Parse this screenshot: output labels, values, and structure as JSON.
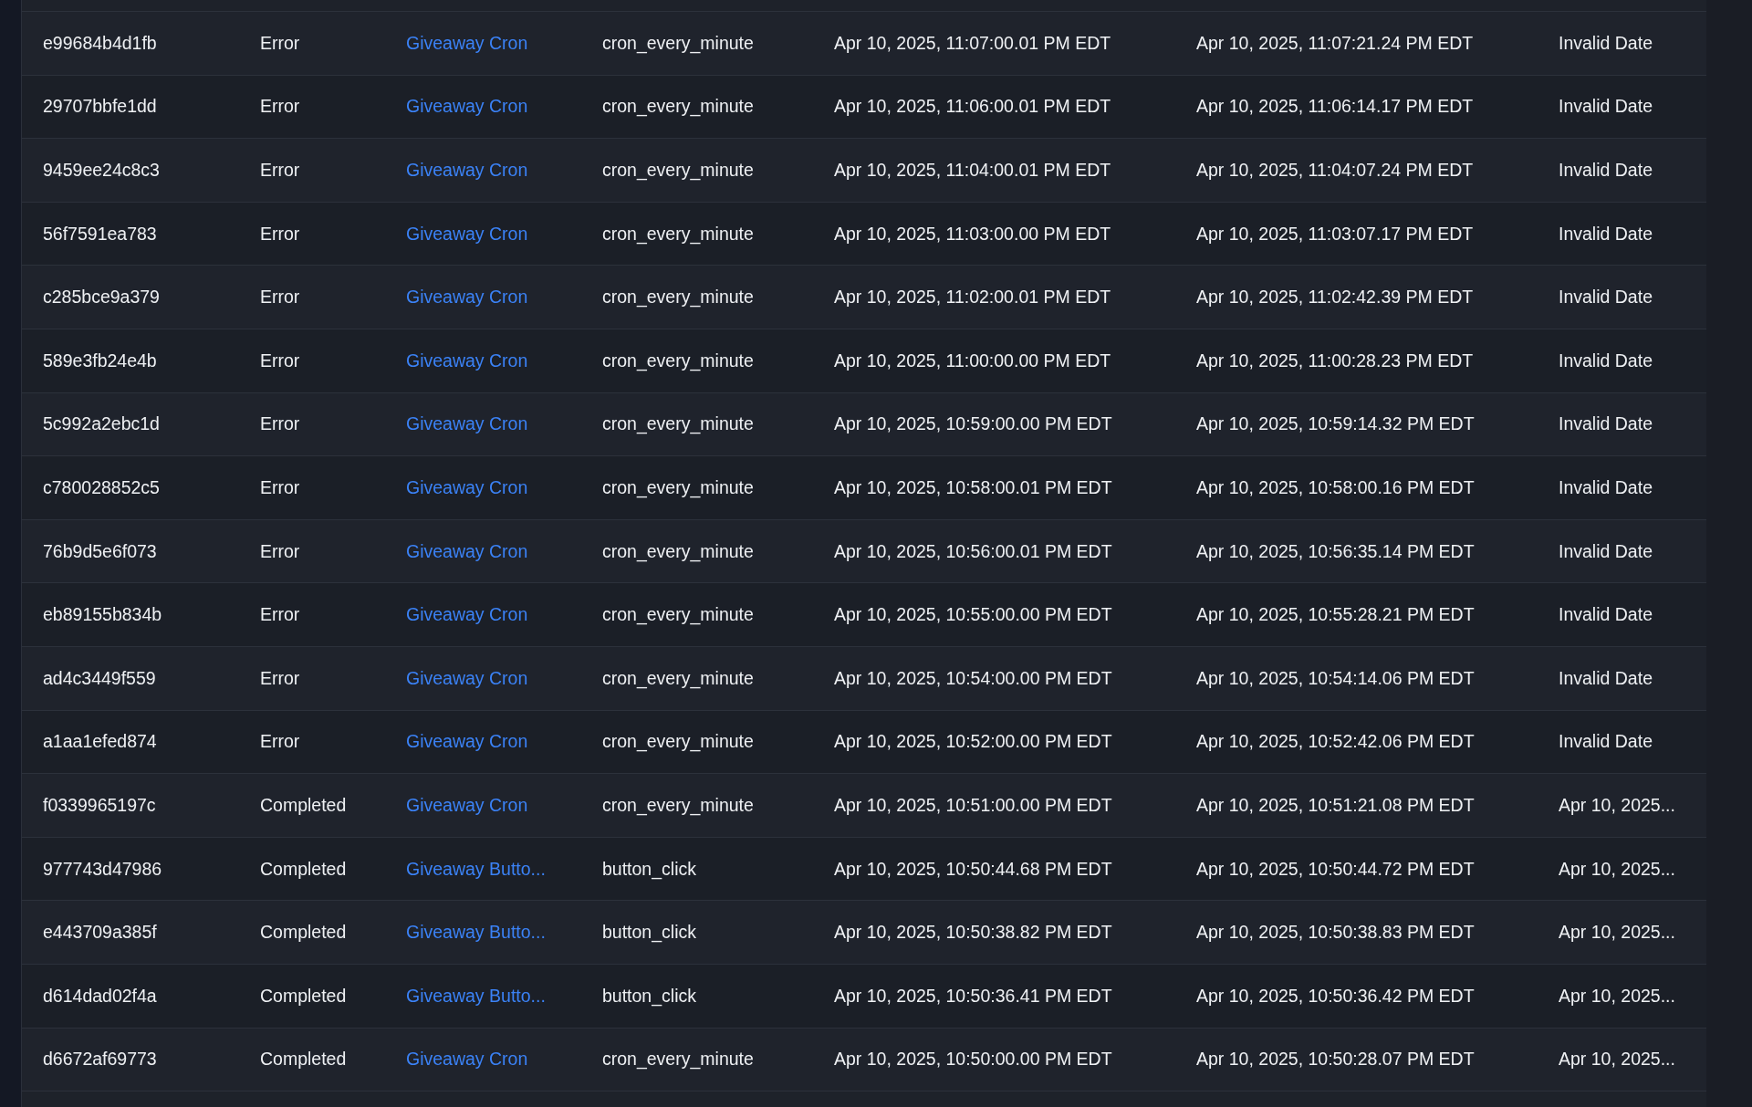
{
  "table": {
    "rows": [
      {
        "cells": [
          {
            "kind": "text",
            "text": "e99684b4d1fb"
          },
          {
            "kind": "text",
            "text": "Error"
          },
          {
            "kind": "link",
            "text": "Giveaway Cron"
          },
          {
            "kind": "text",
            "text": "cron_every_minute"
          },
          {
            "kind": "text",
            "text": "Apr 10, 2025, 11:07:00.01 PM EDT"
          },
          {
            "kind": "text",
            "text": "Apr 10, 2025, 11:07:21.24 PM EDT"
          },
          {
            "kind": "text",
            "text": "Invalid Date"
          }
        ]
      },
      {
        "cells": [
          {
            "kind": "text",
            "text": "29707bbfe1dd"
          },
          {
            "kind": "text",
            "text": "Error"
          },
          {
            "kind": "link",
            "text": "Giveaway Cron"
          },
          {
            "kind": "text",
            "text": "cron_every_minute"
          },
          {
            "kind": "text",
            "text": "Apr 10, 2025, 11:06:00.01 PM EDT"
          },
          {
            "kind": "text",
            "text": "Apr 10, 2025, 11:06:14.17 PM EDT"
          },
          {
            "kind": "text",
            "text": "Invalid Date"
          }
        ]
      },
      {
        "cells": [
          {
            "kind": "text",
            "text": "9459ee24c8c3"
          },
          {
            "kind": "text",
            "text": "Error"
          },
          {
            "kind": "link",
            "text": "Giveaway Cron"
          },
          {
            "kind": "text",
            "text": "cron_every_minute"
          },
          {
            "kind": "text",
            "text": "Apr 10, 2025, 11:04:00.01 PM EDT"
          },
          {
            "kind": "text",
            "text": "Apr 10, 2025, 11:04:07.24 PM EDT"
          },
          {
            "kind": "text",
            "text": "Invalid Date"
          }
        ]
      },
      {
        "cells": [
          {
            "kind": "text",
            "text": "56f7591ea783"
          },
          {
            "kind": "text",
            "text": "Error"
          },
          {
            "kind": "link",
            "text": "Giveaway Cron"
          },
          {
            "kind": "text",
            "text": "cron_every_minute"
          },
          {
            "kind": "text",
            "text": "Apr 10, 2025, 11:03:00.00 PM EDT"
          },
          {
            "kind": "text",
            "text": "Apr 10, 2025, 11:03:07.17 PM EDT"
          },
          {
            "kind": "text",
            "text": "Invalid Date"
          }
        ]
      },
      {
        "cells": [
          {
            "kind": "text",
            "text": "c285bce9a379"
          },
          {
            "kind": "text",
            "text": "Error"
          },
          {
            "kind": "link",
            "text": "Giveaway Cron"
          },
          {
            "kind": "text",
            "text": "cron_every_minute"
          },
          {
            "kind": "text",
            "text": "Apr 10, 2025, 11:02:00.01 PM EDT"
          },
          {
            "kind": "text",
            "text": "Apr 10, 2025, 11:02:42.39 PM EDT"
          },
          {
            "kind": "text",
            "text": "Invalid Date"
          }
        ]
      },
      {
        "cells": [
          {
            "kind": "text",
            "text": "589e3fb24e4b"
          },
          {
            "kind": "text",
            "text": "Error"
          },
          {
            "kind": "link",
            "text": "Giveaway Cron"
          },
          {
            "kind": "text",
            "text": "cron_every_minute"
          },
          {
            "kind": "text",
            "text": "Apr 10, 2025, 11:00:00.00 PM EDT"
          },
          {
            "kind": "text",
            "text": "Apr 10, 2025, 11:00:28.23 PM EDT"
          },
          {
            "kind": "text",
            "text": "Invalid Date"
          }
        ]
      },
      {
        "cells": [
          {
            "kind": "text",
            "text": "5c992a2ebc1d"
          },
          {
            "kind": "text",
            "text": "Error"
          },
          {
            "kind": "link",
            "text": "Giveaway Cron"
          },
          {
            "kind": "text",
            "text": "cron_every_minute"
          },
          {
            "kind": "text",
            "text": "Apr 10, 2025, 10:59:00.00 PM EDT"
          },
          {
            "kind": "text",
            "text": "Apr 10, 2025, 10:59:14.32 PM EDT"
          },
          {
            "kind": "text",
            "text": "Invalid Date"
          }
        ]
      },
      {
        "cells": [
          {
            "kind": "text",
            "text": "c780028852c5"
          },
          {
            "kind": "text",
            "text": "Error"
          },
          {
            "kind": "link",
            "text": "Giveaway Cron"
          },
          {
            "kind": "text",
            "text": "cron_every_minute"
          },
          {
            "kind": "text",
            "text": "Apr 10, 2025, 10:58:00.01 PM EDT"
          },
          {
            "kind": "text",
            "text": "Apr 10, 2025, 10:58:00.16 PM EDT"
          },
          {
            "kind": "text",
            "text": "Invalid Date"
          }
        ]
      },
      {
        "cells": [
          {
            "kind": "text",
            "text": "76b9d5e6f073"
          },
          {
            "kind": "text",
            "text": "Error"
          },
          {
            "kind": "link",
            "text": "Giveaway Cron"
          },
          {
            "kind": "text",
            "text": "cron_every_minute"
          },
          {
            "kind": "text",
            "text": "Apr 10, 2025, 10:56:00.01 PM EDT"
          },
          {
            "kind": "text",
            "text": "Apr 10, 2025, 10:56:35.14 PM EDT"
          },
          {
            "kind": "text",
            "text": "Invalid Date"
          }
        ]
      },
      {
        "cells": [
          {
            "kind": "text",
            "text": "eb89155b834b"
          },
          {
            "kind": "text",
            "text": "Error"
          },
          {
            "kind": "link",
            "text": "Giveaway Cron"
          },
          {
            "kind": "text",
            "text": "cron_every_minute"
          },
          {
            "kind": "text",
            "text": "Apr 10, 2025, 10:55:00.00 PM EDT"
          },
          {
            "kind": "text",
            "text": "Apr 10, 2025, 10:55:28.21 PM EDT"
          },
          {
            "kind": "text",
            "text": "Invalid Date"
          }
        ]
      },
      {
        "cells": [
          {
            "kind": "text",
            "text": "ad4c3449f559"
          },
          {
            "kind": "text",
            "text": "Error"
          },
          {
            "kind": "link",
            "text": "Giveaway Cron"
          },
          {
            "kind": "text",
            "text": "cron_every_minute"
          },
          {
            "kind": "text",
            "text": "Apr 10, 2025, 10:54:00.00 PM EDT"
          },
          {
            "kind": "text",
            "text": "Apr 10, 2025, 10:54:14.06 PM EDT"
          },
          {
            "kind": "text",
            "text": "Invalid Date"
          }
        ]
      },
      {
        "cells": [
          {
            "kind": "text",
            "text": "a1aa1efed874"
          },
          {
            "kind": "text",
            "text": "Error"
          },
          {
            "kind": "link",
            "text": "Giveaway Cron"
          },
          {
            "kind": "text",
            "text": "cron_every_minute"
          },
          {
            "kind": "text",
            "text": "Apr 10, 2025, 10:52:00.00 PM EDT"
          },
          {
            "kind": "text",
            "text": "Apr 10, 2025, 10:52:42.06 PM EDT"
          },
          {
            "kind": "text",
            "text": "Invalid Date"
          }
        ]
      },
      {
        "cells": [
          {
            "kind": "text",
            "text": "f0339965197c"
          },
          {
            "kind": "text",
            "text": "Completed"
          },
          {
            "kind": "link",
            "text": "Giveaway Cron"
          },
          {
            "kind": "text",
            "text": "cron_every_minute"
          },
          {
            "kind": "text",
            "text": "Apr 10, 2025, 10:51:00.00 PM EDT"
          },
          {
            "kind": "text",
            "text": "Apr 10, 2025, 10:51:21.08 PM EDT"
          },
          {
            "kind": "text",
            "text": "Apr 10, 2025..."
          }
        ]
      },
      {
        "cells": [
          {
            "kind": "text",
            "text": "977743d47986"
          },
          {
            "kind": "text",
            "text": "Completed"
          },
          {
            "kind": "link",
            "text": "Giveaway Butto..."
          },
          {
            "kind": "text",
            "text": "button_click"
          },
          {
            "kind": "text",
            "text": "Apr 10, 2025, 10:50:44.68 PM EDT"
          },
          {
            "kind": "text",
            "text": "Apr 10, 2025, 10:50:44.72 PM EDT"
          },
          {
            "kind": "text",
            "text": "Apr 10, 2025..."
          }
        ]
      },
      {
        "cells": [
          {
            "kind": "text",
            "text": "e443709a385f"
          },
          {
            "kind": "text",
            "text": "Completed"
          },
          {
            "kind": "link",
            "text": "Giveaway Butto..."
          },
          {
            "kind": "text",
            "text": "button_click"
          },
          {
            "kind": "text",
            "text": "Apr 10, 2025, 10:50:38.82 PM EDT"
          },
          {
            "kind": "text",
            "text": "Apr 10, 2025, 10:50:38.83 PM EDT"
          },
          {
            "kind": "text",
            "text": "Apr 10, 2025..."
          }
        ]
      },
      {
        "cells": [
          {
            "kind": "text",
            "text": "d614dad02f4a"
          },
          {
            "kind": "text",
            "text": "Completed"
          },
          {
            "kind": "link",
            "text": "Giveaway Butto..."
          },
          {
            "kind": "text",
            "text": "button_click"
          },
          {
            "kind": "text",
            "text": "Apr 10, 2025, 10:50:36.41 PM EDT"
          },
          {
            "kind": "text",
            "text": "Apr 10, 2025, 10:50:36.42 PM EDT"
          },
          {
            "kind": "text",
            "text": "Apr 10, 2025..."
          }
        ]
      },
      {
        "cells": [
          {
            "kind": "text",
            "text": "d6672af69773"
          },
          {
            "kind": "text",
            "text": "Completed"
          },
          {
            "kind": "link",
            "text": "Giveaway Cron"
          },
          {
            "kind": "text",
            "text": "cron_every_minute"
          },
          {
            "kind": "text",
            "text": "Apr 10, 2025, 10:50:00.00 PM EDT"
          },
          {
            "kind": "text",
            "text": "Apr 10, 2025, 10:50:28.07 PM EDT"
          },
          {
            "kind": "text",
            "text": "Apr 10, 2025..."
          }
        ]
      }
    ]
  }
}
